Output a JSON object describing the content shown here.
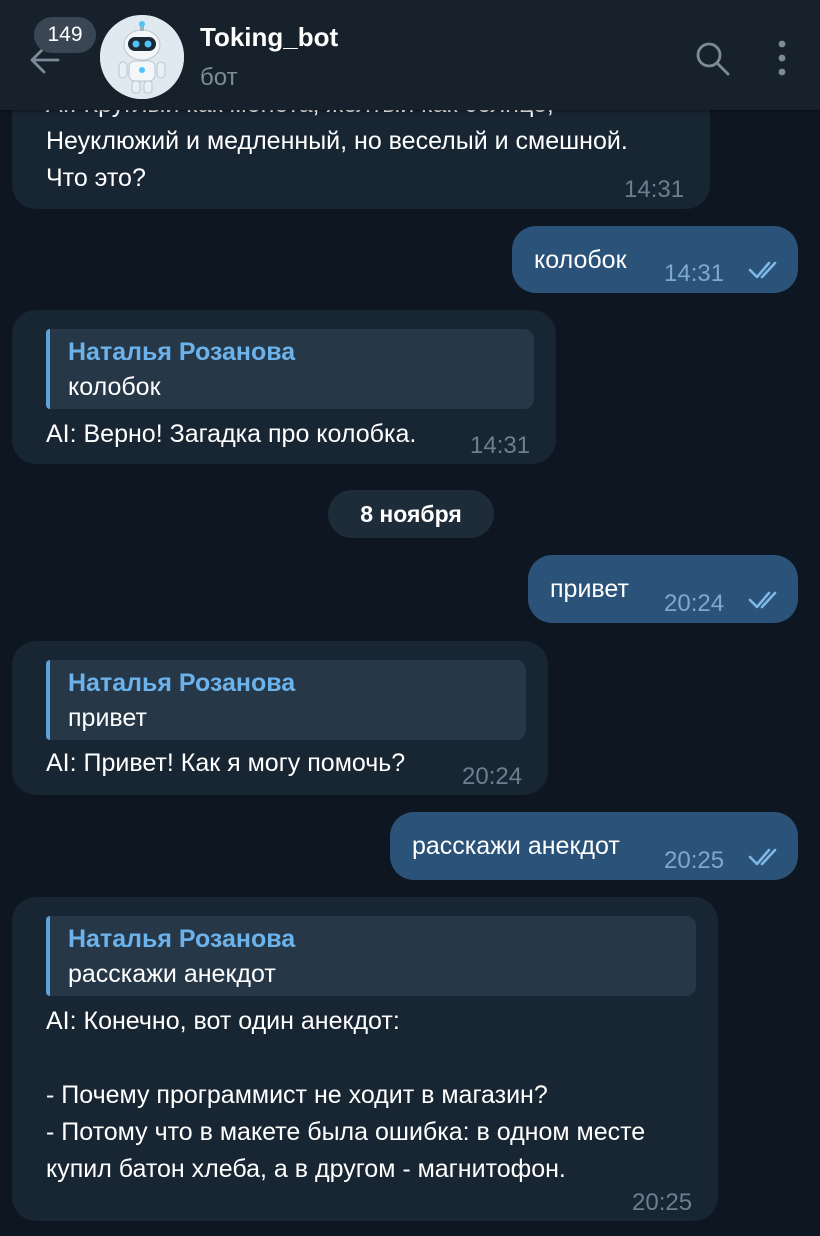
{
  "header": {
    "unread_count": "149",
    "title": "Toking_bot",
    "subtitle": "бот",
    "back_icon": "arrow-left-icon",
    "search_icon": "search-icon",
    "more_icon": "more-vertical-icon"
  },
  "date_separator": "8 ноября",
  "messages": [
    {
      "direction": "in",
      "text": "AI: Круглый как монета, желтый как солнце,\nНеуклюжий и медленный, но веселый и смешной.\nЧто это?",
      "time": "14:31"
    },
    {
      "direction": "out",
      "text": "колобок",
      "time": "14:31",
      "status": "read"
    },
    {
      "direction": "in",
      "reply_name": "Наталья Розанова",
      "reply_text": "колобок",
      "text": "AI: Верно! Загадка про колобка.",
      "time": "14:31"
    },
    {
      "direction": "out",
      "text": "привет",
      "time": "20:24",
      "status": "read"
    },
    {
      "direction": "in",
      "reply_name": "Наталья Розанова",
      "reply_text": "привет",
      "text": "AI: Привет! Как я могу помочь?",
      "time": "20:24"
    },
    {
      "direction": "out",
      "text": "расскажи анекдот",
      "time": "20:25",
      "status": "read"
    },
    {
      "direction": "in",
      "reply_name": "Наталья Розанова",
      "reply_text": "расскажи анекдот",
      "text": "AI: Конечно, вот один анекдот:\n\n- Почему программист не ходит в магазин?\n- Потому что в макете была ошибка: в одном месте\nкупил батон хлеба, а в другом - магнитофон.",
      "time": "20:25"
    }
  ],
  "colors": {
    "background": "#0e1621",
    "header": "#17212b",
    "incoming_bubble": "#182533",
    "outgoing_bubble": "#2b5278",
    "reply_accent": "#6db3eb"
  }
}
